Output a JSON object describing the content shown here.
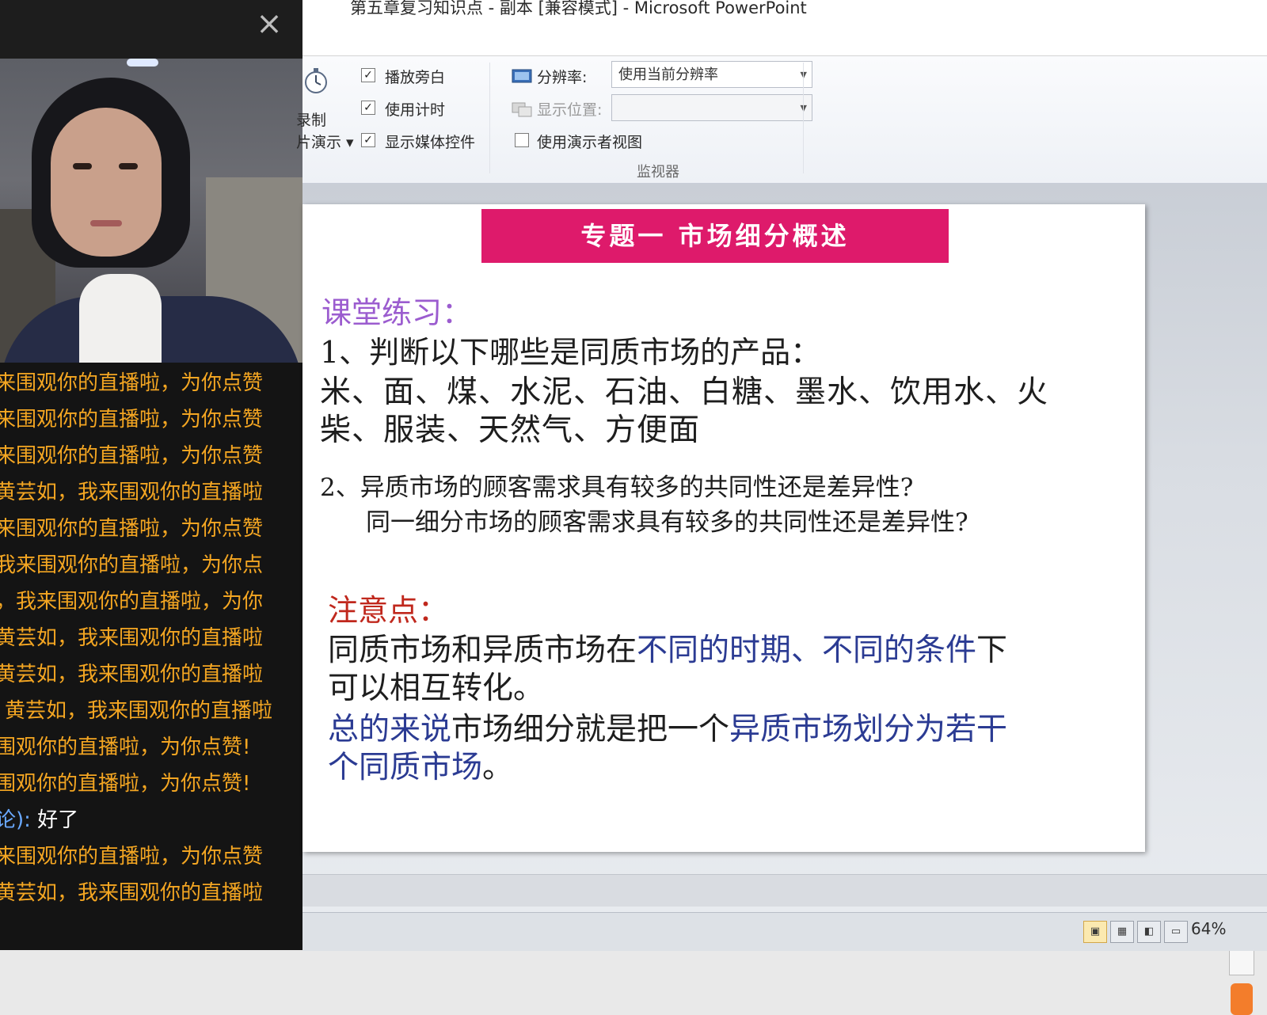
{
  "live_panel": {
    "close_glyph": "×",
    "chat": [
      {
        "text": "来围观你的直播啦，为你点赞"
      },
      {
        "text": "来围观你的直播啦，为你点赞"
      },
      {
        "text": "来围观你的直播啦，为你点赞"
      },
      {
        "text": "黄芸如，我来围观你的直播啦"
      },
      {
        "text": "来围观你的直播啦，为你点赞"
      },
      {
        "text": "我来围观你的直播啦，为你点"
      },
      {
        "text": "，我来围观你的直播啦，为你"
      },
      {
        "text": "黄芸如，我来围观你的直播啦"
      },
      {
        "text": "黄芸如，我来围观你的直播啦"
      },
      {
        "text": "黄芸如，我来围观你的直播啦"
      },
      {
        "text": "围观你的直播啦，为你点赞!"
      },
      {
        "text": "围观你的直播啦，为你点赞!"
      },
      {
        "who": "论):",
        "msg": "好了"
      },
      {
        "text": "来围观你的直播啦，为你点赞"
      },
      {
        "text": "黄芸如，我来围观你的直播啦"
      }
    ]
  },
  "powerpoint": {
    "window_title": "第五章复习知识点 - 副本 [兼容模式] - Microsoft PowerPoint",
    "ribbon": {
      "record_label_1": "录制",
      "record_label_2": "片演示 ▾",
      "play_narration": "播放旁白",
      "use_timings": "使用计时",
      "show_media_controls": "显示媒体控件",
      "resolution_label": "分辨率:",
      "resolution_value": "使用当前分辨率",
      "show_on_label": "显示位置:",
      "presenter_view": "使用演示者视图",
      "group_monitors": "监视器"
    },
    "slide": {
      "title": "专题一 市场细分概述",
      "exercise_heading": "课堂练习：",
      "q1": "1、判断以下哪些是同质市场的产品：",
      "q1_items_line1": "米、面、煤、水泥、石油、白糖、墨水、饮用水、火",
      "q1_items_line2": "柴、服装、天然气、方便面",
      "q2_line1": "2、异质市场的顾客需求具有较多的共同性还是差异性?",
      "q2_line2": "同一细分市场的顾客需求具有较多的共同性还是差异性?",
      "note_heading": "注意点：",
      "note1_a": "同质市场和异质市场在",
      "note1_b": "不同的时期、不同的条件",
      "note1_c": "下",
      "note1_line2": "可以相互转化。",
      "note2_a": "总的来说",
      "note2_b": "市场细分就是把一个",
      "note2_c": "异质市场划分为若干",
      "note2_line2_a": "个同质市场",
      "note2_line2_b": "。"
    },
    "status": {
      "zoom": "64%"
    }
  }
}
